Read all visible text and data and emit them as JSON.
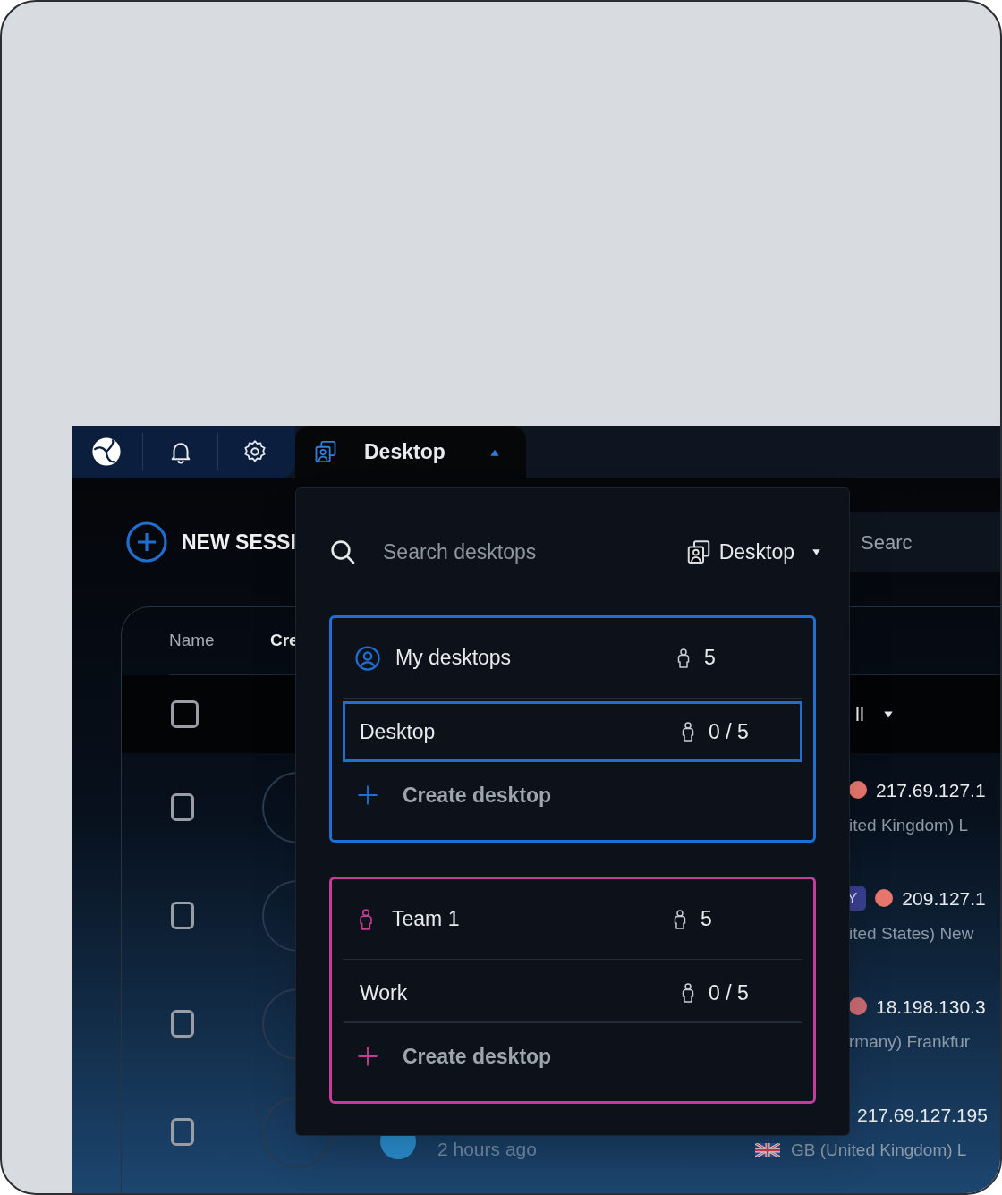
{
  "toolbar": {
    "tab": {
      "label": "Desktop",
      "expanded": true
    }
  },
  "new_session": {
    "label": "NEW SESSI"
  },
  "search": {
    "placeholder": "Searc"
  },
  "table": {
    "columns": [
      "Name",
      "Cre"
    ],
    "select_all": {
      "checked": false
    },
    "filter": {
      "label": "ll"
    },
    "rows": [
      {
        "kind": "covered",
        "checked": false,
        "ip": "217.69.127.1",
        "color": "#e8776d",
        "location": "ited Kingdom) L"
      },
      {
        "kind": "covered",
        "checked": false,
        "badge": "Y",
        "ip": "209.127.1",
        "color": "#e8776d",
        "location": "ited States) New"
      },
      {
        "kind": "covered",
        "checked": false,
        "ip": "18.198.130.3",
        "color": "#c96b72",
        "location": "rmany) Frankfur"
      },
      {
        "kind": "open",
        "checked": false,
        "time": "2 hours ago",
        "ip": "217.69.127.195",
        "location": "GB (United Kingdom) L"
      }
    ]
  },
  "dropdown": {
    "search": {
      "placeholder": "Search desktops"
    },
    "filter": {
      "label": "Desktop"
    },
    "groups": [
      {
        "kind": "personal",
        "name": "My desktops",
        "count": "5",
        "color": "#1f6fd1",
        "desktops": [
          {
            "name": "Desktop",
            "count": "0 / 5",
            "selected": true
          }
        ],
        "create_label": "Create desktop"
      },
      {
        "kind": "team",
        "name": "Team 1",
        "count": "5",
        "color": "#c43c98",
        "desktops": [
          {
            "name": "Work",
            "count": "0 / 5",
            "selected": false
          }
        ],
        "create_label": "Create desktop"
      }
    ]
  }
}
